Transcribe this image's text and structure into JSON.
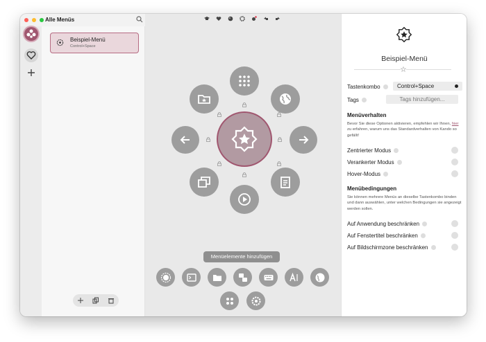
{
  "window": {
    "title": "Alle Menüs"
  },
  "traffic_lights": {
    "close": "#fe5f57",
    "minimize": "#febc2e",
    "zoom": "#28c840"
  },
  "menu_list": [
    {
      "name": "Beispiel-Menü",
      "shortcut": "Control+Space"
    }
  ],
  "list_actions": [
    "plus-icon",
    "copy-icon",
    "trash-icon"
  ],
  "toolbar_icons": [
    "graduation-cap-icon",
    "heart-icon",
    "palette-icon",
    "gear-icon",
    "settings-icon",
    "undo-icon",
    "redo-icon"
  ],
  "add_items": {
    "tooltip": "Menüelemente hinzufügen",
    "items": [
      "ring-icon",
      "terminal-icon",
      "folder-icon",
      "hotkey-icon",
      "keyboard-icon",
      "text-icon",
      "web-icon",
      "redirect-icon",
      "settings-icon"
    ]
  },
  "properties": {
    "title": "Beispiel-Menü",
    "shortcut_label": "Tastenkombo",
    "shortcut_value": "Control+Space",
    "tags_label": "Tags",
    "tags_placeholder": "Tags hinzufügen...",
    "behavior_heading": "Menüverhalten",
    "behavior_text_1": "Bevor Sie diese Optionen aktivieren, empfehlen wir Ihnen, ",
    "behavior_link": "hier",
    "behavior_text_2": " zu erfahren, warum uns das Standardverhalten von Kando so gefällt!",
    "toggles_behavior": [
      "Zentrierter Modus",
      "Verankerter Modus",
      "Hover-Modus"
    ],
    "conditions_heading": "Menübedingungen",
    "conditions_text": "Sie können mehrere Menüs an dieselbe Tastenkombo binden und dann auswählen, unter welchen Bedingungen sie angezeigt werden sollen.",
    "toggles_conditions": [
      "Auf Anwendung beschränken",
      "Auf Fenstertitel beschränken",
      "Auf Bildschirmzone beschränken"
    ]
  },
  "accent_color": "#a0566f"
}
